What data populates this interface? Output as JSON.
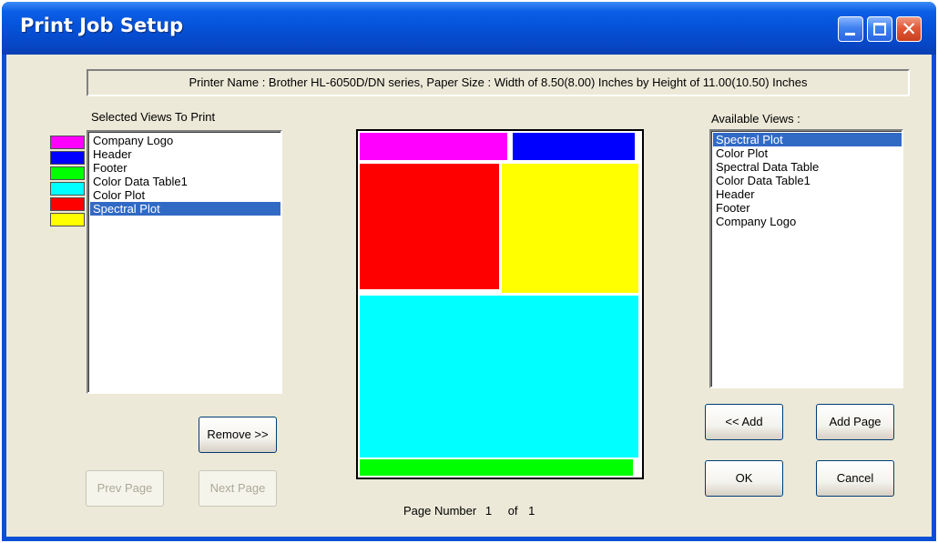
{
  "window": {
    "title": "Print Job Setup"
  },
  "printer_info": "Printer Name : Brother HL-6050D/DN series, Paper Size : Width of 8.50(8.00) Inches by Height of 11.00(10.50) Inches",
  "selected_views": {
    "label": "Selected Views To Print",
    "items": [
      {
        "label": "Company Logo",
        "color": "#ff00ff",
        "selected": false
      },
      {
        "label": "Header",
        "color": "#0000ff",
        "selected": false
      },
      {
        "label": "Footer",
        "color": "#00ff00",
        "selected": false
      },
      {
        "label": "Color Data Table1",
        "color": "#00ffff",
        "selected": false
      },
      {
        "label": "Color Plot",
        "color": "#ff0000",
        "selected": false
      },
      {
        "label": "Spectral Plot",
        "color": "#ffff00",
        "selected": true
      }
    ]
  },
  "available_views": {
    "label": "Available Views :",
    "items": [
      {
        "label": "Spectral Plot",
        "selected": true
      },
      {
        "label": "Color Plot",
        "selected": false
      },
      {
        "label": "Spectral Data Table",
        "selected": false
      },
      {
        "label": "Color Data Table1",
        "selected": false
      },
      {
        "label": "Header",
        "selected": false
      },
      {
        "label": "Footer",
        "selected": false
      },
      {
        "label": "Company Logo",
        "selected": false
      }
    ]
  },
  "buttons": {
    "remove": "Remove >>",
    "prev_page": "Prev Page",
    "next_page": "Next Page",
    "add": "<< Add",
    "add_page": "Add Page",
    "ok": "OK",
    "cancel": "Cancel"
  },
  "pagination": {
    "prefix": "Page Number",
    "current": "1",
    "separator": "of",
    "total": "1"
  },
  "colors": {
    "selection": "#316ac5",
    "dialog_bg": "#ece9d8",
    "title_bar": "#0553da"
  }
}
